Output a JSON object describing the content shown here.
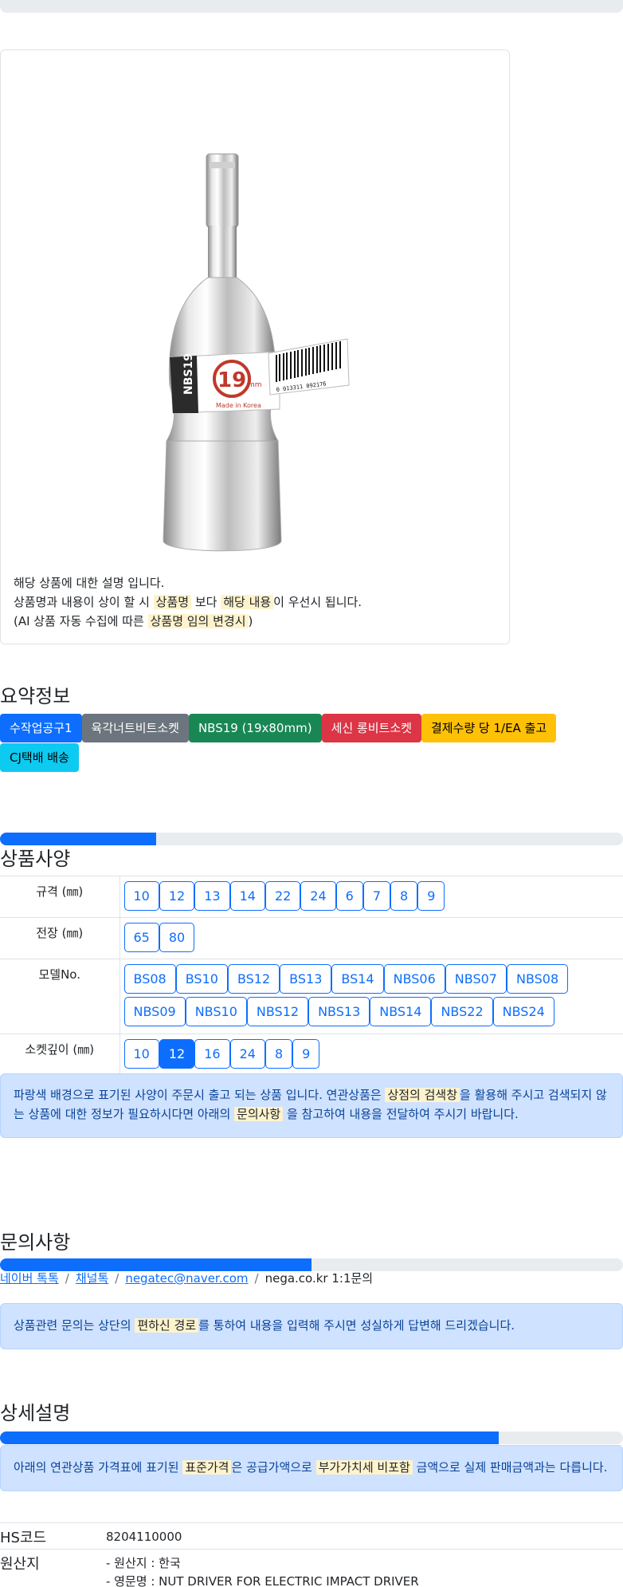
{
  "description": {
    "line1": "해당 상품에 대한 설명 입니다.",
    "line2_pre": "상품명과 내용이 상이 할 시 ",
    "line2_hl1": "상품명",
    "line2_mid": " 보다 ",
    "line2_hl2": "해당 내용",
    "line2_post": "이 우선시 됩니다.",
    "line3_pre": "(AI 상품 자동 수집에 따른 ",
    "line3_hl": "상품명 임의 변경시",
    "line3_post": ")"
  },
  "product_image": {
    "label_model": "NBS19",
    "label_size": "19",
    "label_unit": "mm",
    "label_made": "Made in Korea",
    "barcode_text": "0 013311 092176"
  },
  "summary": {
    "title": "요약정보",
    "badges": [
      {
        "label": "수작업공구1",
        "color": "#0d6efd",
        "text_color": "#ffffff"
      },
      {
        "label": "육각너트비트소켓",
        "color": "#6c757d",
        "text_color": "#ffffff"
      },
      {
        "label": "NBS19 (19x80mm)",
        "color": "#198754",
        "text_color": "#ffffff"
      },
      {
        "label": "세신 롱비트소켓",
        "color": "#dc3545",
        "text_color": "#ffffff"
      },
      {
        "label": "결제수량 당 1/EA 출고",
        "color": "#ffc107",
        "text_color": "#000000"
      },
      {
        "label": "CJ택배 배송",
        "color": "#0dcaf0",
        "text_color": "#000000"
      }
    ]
  },
  "spec": {
    "title": "상품사양",
    "progress": 0.25,
    "rows": [
      {
        "label": "규격 (㎜)",
        "options": [
          "10",
          "12",
          "13",
          "14",
          "22",
          "24",
          "6",
          "7",
          "8",
          "9"
        ],
        "active": null
      },
      {
        "label": "전장 (㎜)",
        "options": [
          "65",
          "80"
        ],
        "active": null
      },
      {
        "label": "모델No.",
        "options": [
          "BS08",
          "BS10",
          "BS12",
          "BS13",
          "BS14",
          "NBS06",
          "NBS07",
          "NBS08",
          "NBS09",
          "NBS10",
          "NBS12",
          "NBS13",
          "NBS14",
          "NBS22",
          "NBS24"
        ],
        "active": null
      },
      {
        "label": "소켓깊이 (㎜)",
        "options": [
          "10",
          "12",
          "16",
          "24",
          "8",
          "9"
        ],
        "active": "12"
      }
    ],
    "notice_pre": "파랑색 배경으로 표기된 사양이 주문시 출고 되는 상품 입니다. 연관상품은 ",
    "notice_hl1": "상점의 검색창",
    "notice_mid": "을 활용해 주시고 검색되지 않는 상품에 대한 정보가 필요하시다면 아래의 ",
    "notice_hl2": "문의사항",
    "notice_post": " 을 참고하여 내용을 전달하여 주시기 바랍니다."
  },
  "inquiry": {
    "title": "문의사항",
    "progress": 0.5,
    "links": [
      "네이버 톡톡",
      "채널톡",
      "negatec@naver.com"
    ],
    "plain": "nega.co.kr 1:1문의",
    "sep": "/",
    "notice_pre": "상품관련 문의는 상단의 ",
    "notice_hl": "편하신 경로",
    "notice_post": "를 통하여 내용을 입력해 주시면 성실하게 답변해 드리겠습니다."
  },
  "detail": {
    "title": "상세설명",
    "progress": 0.8,
    "notice_pre": "아래의 연관상품 가격표에 표기된 ",
    "notice_hl1": "표준가격",
    "notice_mid": "은 공급가액으로 ",
    "notice_hl2": "부가가치세 비포함",
    "notice_post": " 금액으로 실제 판매금액과는 다릅니다."
  },
  "info": {
    "hs_label": "HS코드",
    "hs_value": "8204110000",
    "origin_label": "원산지",
    "origin_line1": "- 원산지 : 한국",
    "origin_line2": "- 영문명 : NUT DRIVER FOR ELECTRIC IMPACT DRIVER"
  }
}
